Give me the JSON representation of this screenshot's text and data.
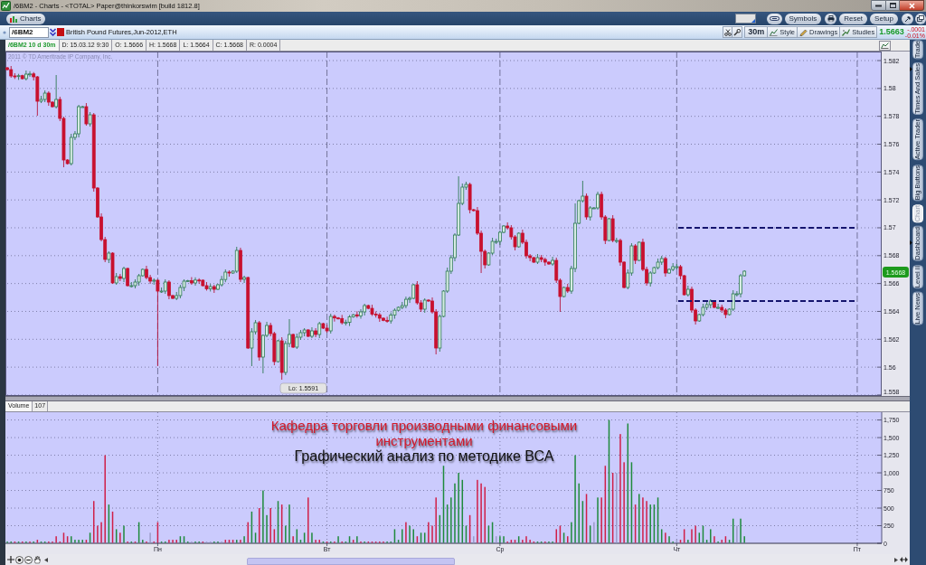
{
  "window": {
    "title": "/6BM2 - Charts - <TOTAL> Paper@thinkorswim [build 1812.8]"
  },
  "toolbar": {
    "tab": "Charts",
    "buttons": [
      "Symbols",
      "Reset",
      "Setup"
    ]
  },
  "symbol_bar": {
    "symbol": "/6BM2",
    "description": "British Pound Futures,Jun-2012,ETH",
    "aggregation": "30m",
    "buttons": [
      "Style",
      "Drawings",
      "Studies"
    ],
    "last_price": "1.5663",
    "net_change": "-.0001",
    "percent_change": "-0.01%"
  },
  "info_bar": {
    "study": "/6BM2 10 d 30m",
    "fields": [
      "D: 15.03.12 9:30",
      "O: 1.5666",
      "H: 1.5668",
      "L: 1.5664",
      "C: 1.5668",
      "R: 0.0004"
    ]
  },
  "price_chart": {
    "copyright": "2011 © TD Ameritrade IP Company, Inc.",
    "y_labels": [
      "1.582",
      "1.58",
      "1.578",
      "1.576",
      "1.574",
      "1.572",
      "1.57",
      "1.568",
      "1.566",
      "1.564",
      "1.562",
      "1.56",
      "1.558"
    ],
    "current_price": "1.5668",
    "low_label": "Lo: 1.5591"
  },
  "volume": {
    "title": "Volume",
    "reading": "107",
    "chart_data": {
      "type": "bar",
      "grid": true,
      "categories": [
        null,
        null,
        null,
        null,
        null,
        null,
        null,
        null,
        null,
        null,
        null,
        null,
        null,
        null,
        null,
        null,
        null,
        null,
        null,
        null,
        null,
        null,
        null,
        null,
        null,
        null,
        null,
        null,
        null,
        null,
        null,
        null,
        null,
        null,
        null,
        null,
        null,
        null,
        null,
        null,
        "Пн",
        null,
        null,
        null,
        null,
        null,
        null,
        null,
        null,
        null,
        null,
        null,
        null,
        null,
        null,
        null,
        null,
        null,
        null,
        null,
        null,
        null,
        null,
        null,
        null,
        null,
        null,
        null,
        null,
        null,
        null,
        null,
        null,
        null,
        null,
        null,
        null,
        null,
        null,
        null,
        null,
        null,
        null,
        null,
        null,
        "Вт",
        null,
        null,
        null,
        null,
        null,
        null,
        null,
        null,
        null,
        null,
        null,
        null,
        null,
        null,
        null,
        null,
        null,
        null,
        null,
        null,
        null,
        null,
        null,
        null,
        null,
        null,
        null,
        null,
        null,
        null,
        null,
        null,
        null,
        null,
        null,
        null,
        null,
        null,
        null,
        null,
        null,
        null,
        null,
        null,
        null,
        "Ср",
        null,
        null,
        null,
        null,
        null,
        null,
        null,
        null,
        null,
        null,
        null,
        null,
        null,
        null,
        null,
        null,
        null,
        null,
        null,
        null,
        null,
        null,
        null,
        null,
        null,
        null,
        null,
        null,
        null,
        null,
        null,
        null,
        null,
        null,
        null,
        null,
        null,
        null,
        null,
        null,
        null,
        null,
        null,
        null,
        null,
        null,
        "Чт",
        null,
        null,
        null,
        null,
        null,
        null,
        null,
        null,
        null,
        null,
        null,
        null,
        null,
        null,
        null,
        null,
        null,
        null,
        null,
        null,
        null,
        null,
        null,
        null,
        null,
        null,
        null,
        null,
        null,
        null,
        null,
        null,
        null,
        null,
        null,
        null,
        null,
        null,
        null,
        null,
        null,
        null,
        null,
        null,
        null,
        null,
        null,
        "Пт",
        null,
        null,
        null,
        null,
        null,
        null
      ],
      "ylim": [
        0,
        1860
      ],
      "yticks": [
        0,
        250,
        500,
        750,
        {
          "value": 1000,
          "label": "1,000"
        },
        {
          "value": 1250,
          "label": "1,250"
        },
        {
          "value": 1500,
          "label": "1,500"
        },
        {
          "value": 1750,
          "label": "1,750"
        }
      ],
      "series": [
        {
          "color": "#1f8a3c",
          "values": [
            0,
            0,
            null,
            0,
            null,
            0,
            null,
            0,
            null,
            0,
            0,
            null,
            null,
            null,
            null,
            null,
            null,
            100,
            50,
            50,
            50,
            null,
            150,
            null,
            null,
            null,
            null,
            550,
            null,
            200,
            null,
            250,
            null,
            0,
            null,
            300,
            50,
            null,
            null,
            null,
            null,
            0,
            0,
            null,
            null,
            null,
            100,
            100,
            0,
            null,
            0,
            0,
            null,
            null,
            null,
            0,
            0,
            null,
            null,
            null,
            null,
            50,
            null,
            100,
            null,
            450,
            150,
            null,
            750,
            400,
            null,
            null,
            600,
            null,
            250,
            550,
            null,
            200,
            50,
            150,
            null,
            150,
            null,
            null,
            0,
            null,
            0,
            null,
            100,
            null,
            0,
            100,
            null,
            100,
            null,
            0,
            null,
            null,
            null,
            null,
            null,
            0,
            0,
            200,
            50,
            200,
            null,
            250,
            200,
            null,
            150,
            150,
            null,
            null,
            null,
            400,
            1100,
            550,
            650,
            850,
            1000,
            900,
            250,
            null,
            null,
            null,
            null,
            null,
            250,
            300,
            null,
            100,
            100,
            null,
            null,
            null,
            100,
            null,
            null,
            null,
            null,
            0,
            0,
            null,
            0,
            0,
            null,
            null,
            150,
            null,
            300,
            1250,
            850,
            600,
            null,
            250,
            null,
            650,
            null,
            null,
            1750,
            null,
            null,
            null,
            null,
            1700,
            1150,
            null,
            700,
            null,
            null,
            550,
            550,
            650,
            200,
            null,
            100,
            0,
            null,
            null,
            null,
            50,
            null,
            null,
            150,
            250,
            50,
            200,
            null,
            0,
            null,
            null,
            50,
            350,
            null,
            350,
            100,
            null,
            null,
            null,
            null,
            null,
            null,
            null,
            null,
            null,
            null,
            null,
            null,
            null,
            null,
            null,
            null,
            null,
            null,
            null,
            null,
            null,
            null,
            null,
            null,
            null,
            null,
            null,
            null,
            null,
            null,
            null,
            null,
            null,
            null,
            null,
            null
          ]
        },
        {
          "color": "#d01f48",
          "values": [
            null,
            null,
            0,
            null,
            0,
            null,
            0,
            null,
            50,
            null,
            null,
            0,
            0,
            100,
            0,
            150,
            100,
            null,
            null,
            null,
            null,
            50,
            null,
            600,
            250,
            300,
            1250,
            null,
            450,
            null,
            150,
            null,
            0,
            null,
            0,
            null,
            null,
            0,
            null,
            0,
            300,
            null,
            null,
            50,
            50,
            50,
            null,
            null,
            null,
            null,
            null,
            null,
            0,
            null,
            null,
            null,
            null,
            null,
            50,
            50,
            50,
            null,
            50,
            null,
            300,
            null,
            null,
            500,
            null,
            null,
            500,
            200,
            null,
            550,
            null,
            null,
            100,
            null,
            null,
            null,
            650,
            null,
            50,
            50,
            null,
            0,
            null,
            0,
            null,
            0,
            null,
            null,
            50,
            null,
            0,
            null,
            0,
            0,
            0,
            0,
            0,
            null,
            null,
            null,
            null,
            null,
            300,
            null,
            null,
            100,
            null,
            null,
            300,
            250,
            650,
            null,
            null,
            null,
            null,
            null,
            null,
            null,
            null,
            400,
            null,
            900,
            850,
            800,
            null,
            null,
            null,
            null,
            null,
            0,
            50,
            50,
            null,
            50,
            100,
            50,
            0,
            null,
            null,
            0,
            null,
            null,
            200,
            250,
            null,
            100,
            null,
            null,
            null,
            null,
            700,
            null,
            null,
            null,
            650,
            1100,
            null,
            1000,
            null,
            1550,
            1150,
            null,
            null,
            550,
            null,
            650,
            600,
            null,
            null,
            null,
            null,
            150,
            null,
            null,
            null,
            50,
            200,
            null,
            200,
            250,
            null,
            null,
            null,
            null,
            100,
            null,
            50,
            100,
            null,
            null,
            null,
            null,
            null,
            null,
            null,
            null,
            null,
            null,
            null,
            null,
            null,
            null,
            null,
            null,
            null,
            null,
            null,
            null,
            null,
            null,
            null,
            null,
            null,
            null,
            null,
            null,
            null,
            null,
            null,
            null,
            null,
            null,
            null,
            null,
            null,
            null,
            null,
            null,
            null
          ]
        },
        {
          "color": "#9c9cc8",
          "values": [
            null,
            null,
            null,
            null,
            null,
            null,
            null,
            null,
            null,
            null,
            null,
            null,
            null,
            null,
            null,
            null,
            null,
            null,
            null,
            null,
            null,
            null,
            null,
            null,
            null,
            null,
            null,
            null,
            null,
            null,
            null,
            null,
            null,
            null,
            null,
            null,
            null,
            null,
            150,
            null,
            null,
            null,
            null,
            null,
            null,
            null,
            null,
            null,
            null,
            0,
            null,
            null,
            null,
            0,
            0,
            null,
            null,
            0,
            null,
            null,
            null,
            null,
            null,
            null,
            null,
            null,
            null,
            null,
            null,
            null,
            null,
            null,
            null,
            null,
            null,
            null,
            null,
            null,
            null,
            null,
            null,
            null,
            null,
            null,
            null,
            null,
            null,
            null,
            null,
            null,
            null,
            null,
            null,
            null,
            null,
            null,
            null,
            null,
            null,
            null,
            null,
            null,
            null,
            null,
            null,
            null,
            null,
            null,
            null,
            null,
            null,
            null,
            null,
            null,
            null,
            null,
            null,
            null,
            null,
            null,
            null,
            null,
            null,
            null,
            100,
            null,
            null,
            null,
            null,
            null,
            100,
            null,
            null,
            null,
            null,
            null,
            null,
            null,
            null,
            null,
            null,
            null,
            null,
            null,
            null,
            null,
            null,
            null,
            null,
            null,
            null,
            null,
            null,
            null,
            null,
            null,
            300,
            null,
            null,
            null,
            null,
            null,
            1000,
            null,
            null,
            null,
            null,
            null,
            null,
            null,
            null,
            null,
            null,
            null,
            null,
            null,
            null,
            null,
            50,
            null,
            null,
            null,
            null,
            null,
            null,
            null,
            null,
            null,
            null,
            null,
            null,
            null,
            null,
            null,
            250,
            null,
            null,
            null,
            null,
            null,
            null,
            null,
            null,
            null,
            null,
            null,
            null,
            null,
            null,
            null,
            null,
            null,
            null,
            null,
            null,
            null,
            null,
            null,
            null,
            null,
            null,
            null,
            null,
            null,
            null,
            null,
            null,
            null,
            null,
            null,
            null,
            null,
            null
          ]
        }
      ]
    }
  },
  "caption": [
    {
      "kind": "title",
      "text": "Кафедра торговли производными финансовыми инструментами"
    },
    {
      "kind": "subtitle",
      "text": "Графический анализ по методике ВСА"
    }
  ],
  "side_tabs": [
    {
      "label": "Trade",
      "selected": false
    },
    {
      "label": "Times And Sales",
      "selected": false
    },
    {
      "label": "Active Trader",
      "selected": false
    },
    {
      "label": "Big Buttons",
      "selected": false
    },
    {
      "label": "Chart",
      "selected": true
    },
    {
      "label": "Dashboard",
      "selected": false
    },
    {
      "label": "Level II",
      "selected": false
    },
    {
      "label": "Live News",
      "selected": false
    }
  ]
}
